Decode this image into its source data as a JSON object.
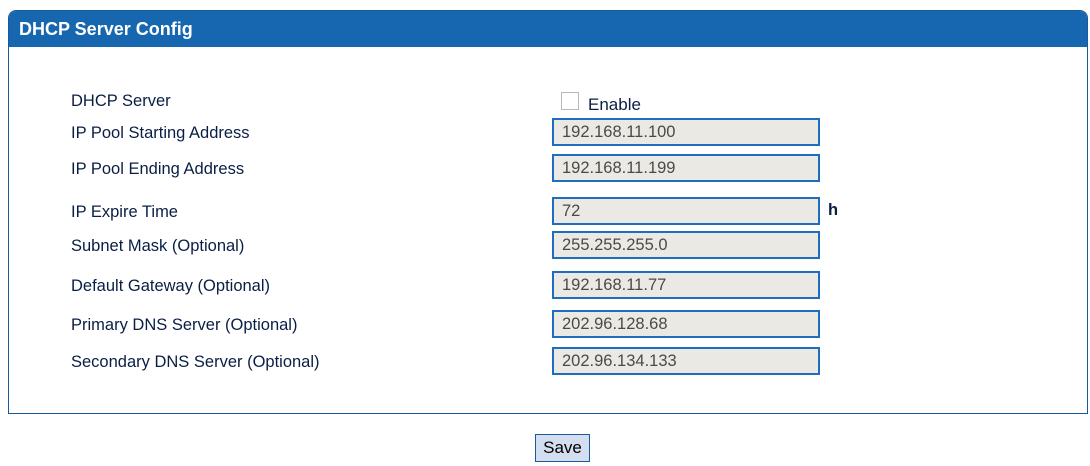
{
  "panel": {
    "title": "DHCP Server Config"
  },
  "dhcp_server": {
    "label": "DHCP Server",
    "checkbox_label": "Enable",
    "checked": false
  },
  "fields": {
    "pool_start": {
      "label": "IP Pool Starting Address",
      "value": "192.168.11.100"
    },
    "pool_end": {
      "label": "IP Pool Ending Address",
      "value": "192.168.11.199"
    },
    "expire_time": {
      "label": "IP Expire Time",
      "value": "72",
      "unit": "h"
    },
    "subnet_mask": {
      "label": "Subnet Mask (Optional)",
      "value": "255.255.255.0"
    },
    "default_gateway": {
      "label": "Default Gateway (Optional)",
      "value": "192.168.11.77"
    },
    "primary_dns": {
      "label": "Primary DNS Server (Optional)",
      "value": "202.96.128.68"
    },
    "secondary_dns": {
      "label": "Secondary DNS Server (Optional)",
      "value": "202.96.134.133"
    }
  },
  "actions": {
    "save_label": "Save"
  },
  "colors": {
    "header_bg": "#1767b0",
    "field_border": "#1f6dbd",
    "field_bg": "#ebe9e3",
    "label_text": "#0a1e44"
  }
}
